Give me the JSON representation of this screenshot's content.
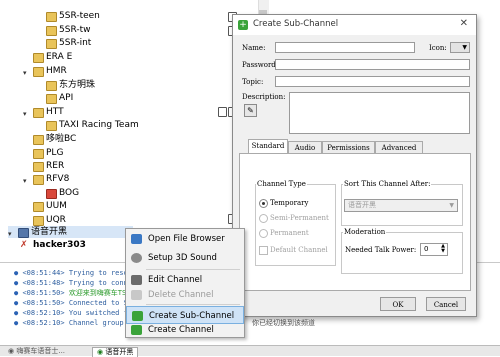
{
  "tree": {
    "items": [
      {
        "label": "5SR-teen"
      },
      {
        "label": "5SR-tw"
      },
      {
        "label": "5SR-int"
      },
      {
        "label": "ERA E"
      },
      {
        "label": "HMR"
      },
      {
        "label": "东方明珠"
      },
      {
        "label": "API"
      },
      {
        "label": "HTT"
      },
      {
        "label": "TAXI Racing Team"
      },
      {
        "label": "哆啦BC"
      },
      {
        "label": "PLG"
      },
      {
        "label": "RER"
      },
      {
        "label": "RFV8"
      },
      {
        "label": "BOG"
      },
      {
        "label": "UUM"
      },
      {
        "label": "UQR"
      },
      {
        "label": "语音开黑"
      },
      {
        "label": "hacker303"
      }
    ]
  },
  "context_menu": {
    "items": [
      {
        "label": "Open File Browser"
      },
      {
        "label": "Setup 3D Sound"
      },
      {
        "label": "Edit Channel"
      },
      {
        "label": "Delete Channel"
      },
      {
        "label": "Create Sub-Channel"
      },
      {
        "label": "Create Channel"
      }
    ]
  },
  "log": {
    "lines": [
      {
        "time": "<08:51:44>",
        "text": "Trying to resolve"
      },
      {
        "time": "<08:51:48>",
        "text": "Trying to connect"
      },
      {
        "time": "<08:51:50>",
        "text": "欢迎来到嗨赛车TS"
      },
      {
        "time": "<08:51:50>",
        "text": "Connected to Serve"
      },
      {
        "time": "<08:52:10>",
        "text": "You switched from"
      },
      {
        "time": "<08:52:10>",
        "text": "Channel group \"Gue"
      }
    ],
    "behind_text": "你已经切换到该频道"
  },
  "bottom_tabs": [
    {
      "label": "嗨赛车语音士..."
    },
    {
      "label": "语音开黑"
    }
  ],
  "dialog": {
    "title": "Create Sub-Channel",
    "name_label": "Name:",
    "icon_label": "Icon:",
    "password_label": "Password:",
    "topic_label": "Topic:",
    "description_label": "Description:",
    "tabs": [
      {
        "label": "Standard"
      },
      {
        "label": "Audio"
      },
      {
        "label": "Permissions"
      },
      {
        "label": "Advanced"
      }
    ],
    "channel_type": {
      "title": "Channel Type",
      "options": [
        {
          "label": "Temporary"
        },
        {
          "label": "Semi-Permanent"
        },
        {
          "label": "Permanent"
        }
      ],
      "default_channel_label": "Default Channel"
    },
    "sort": {
      "title": "Sort This Channel After:",
      "value": "语音开黑"
    },
    "moderation": {
      "title": "Moderation",
      "talk_power_label": "Needed Talk Power:",
      "talk_power_value": "0"
    },
    "ok_label": "OK",
    "cancel_label": "Cancel"
  }
}
